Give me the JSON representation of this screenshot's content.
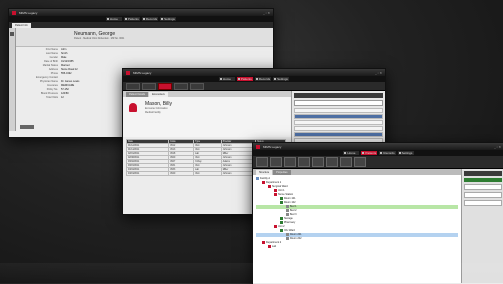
{
  "app_title": "MIMS Legacy",
  "nav": [
    "Home",
    "Patients",
    "Records",
    "Settings"
  ],
  "window_back": {
    "tab": "Patient Info",
    "patient_name": "Neumann, George",
    "patient_sub": [
      "Patient",
      "Medical Clinic Rotterdam",
      "MR No. 0001"
    ],
    "fields": [
      {
        "k": "First Name",
        "v": "John"
      },
      {
        "k": "Last Name",
        "v": "Smith"
      },
      {
        "k": "Gender",
        "v": "Male"
      },
      {
        "k": "Date of Birth",
        "v": "01/12/1955"
      },
      {
        "k": "Marital Status",
        "v": "Married"
      },
      {
        "k": "Address",
        "v": "Stone Road 12"
      },
      {
        "k": "Phone",
        "v": "555-0192"
      },
      {
        "k": "Emergency Contact",
        "v": ""
      },
      {
        "k": "Physician Name",
        "v": "Dr. James Lewis"
      },
      {
        "k": "Insurance",
        "v": "MEDICARE"
      },
      {
        "k": "Policy No.",
        "v": "57-152"
      },
      {
        "k": "Blood Pressure",
        "v": "120/80"
      },
      {
        "k": "Total Visits",
        "v": "12"
      }
    ]
  },
  "window_mid": {
    "tabs": [
      "Patient Details",
      "Encounters"
    ],
    "patient_name": "Mason, Billy",
    "patient_sub": [
      "Encounter Information",
      "Medical Facility"
    ],
    "table_headers": [
      "Date",
      "Code",
      "Type",
      "Provider",
      "Status"
    ],
    "table_rows": [
      [
        "01/12/2011",
        "4512",
        "Visit",
        "Johnson",
        "Closed"
      ],
      [
        "01/14/2011",
        "4513",
        "Visit",
        "Johnson",
        "Closed"
      ],
      [
        "02/01/2011",
        "4518",
        "Lab",
        "Miller",
        "Closed"
      ],
      [
        "02/08/2011",
        "4520",
        "Visit",
        "Johnson",
        "Closed"
      ],
      [
        "03/02/2011",
        "4527",
        "X-Ray",
        "Adams",
        "Closed"
      ],
      [
        "03/15/2011",
        "4531",
        "Visit",
        "Johnson",
        "Closed"
      ],
      [
        "04/04/2011",
        "4533",
        "Lab",
        "Miller",
        "Closed"
      ],
      [
        "04/19/2011",
        "4540",
        "Visit",
        "Johnson",
        "Open"
      ]
    ],
    "side_rows": 8
  },
  "window_front": {
    "tabs": [
      "Structure",
      "Properties"
    ],
    "tree": [
      {
        "label": "Facility A",
        "indent": 0,
        "hl": ""
      },
      {
        "label": "Department 1",
        "indent": 1,
        "hl": ""
      },
      {
        "label": "Surgical Ward",
        "indent": 2,
        "hl": ""
      },
      {
        "label": "Unit 1",
        "indent": 3,
        "hl": ""
      },
      {
        "label": "Nurse Station",
        "indent": 3,
        "hl": ""
      },
      {
        "label": "Room 101",
        "indent": 4,
        "hl": ""
      },
      {
        "label": "Room 102",
        "indent": 4,
        "hl": ""
      },
      {
        "label": "Bed 1",
        "indent": 5,
        "hl": "green"
      },
      {
        "label": "Bed 2",
        "indent": 5,
        "hl": ""
      },
      {
        "label": "Bed 3",
        "indent": 5,
        "hl": ""
      },
      {
        "label": "Storage",
        "indent": 4,
        "hl": ""
      },
      {
        "label": "Pharmacy",
        "indent": 4,
        "hl": ""
      },
      {
        "label": "Unit 2",
        "indent": 3,
        "hl": ""
      },
      {
        "label": "ICU Ward",
        "indent": 4,
        "hl": ""
      },
      {
        "label": "Room 201",
        "indent": 5,
        "hl": "blue"
      },
      {
        "label": "Room 202",
        "indent": 5,
        "hl": ""
      },
      {
        "label": "Department 2",
        "indent": 1,
        "hl": ""
      },
      {
        "label": "Lab",
        "indent": 2,
        "hl": ""
      }
    ]
  },
  "colors": {
    "accent": "#c8102e",
    "chrome": "#1a1a1a"
  }
}
